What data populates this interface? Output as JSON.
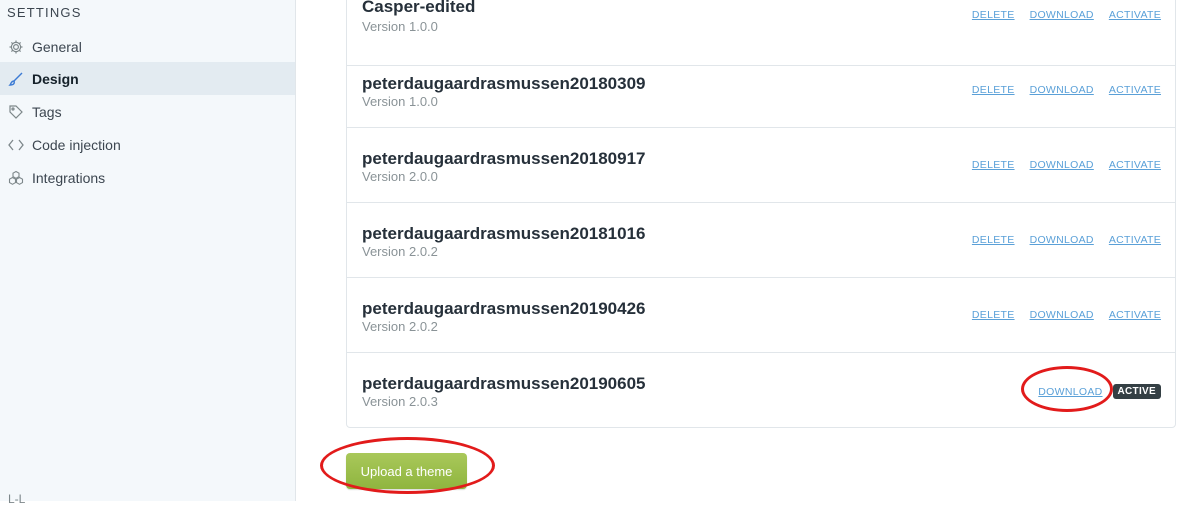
{
  "sidebar": {
    "heading": "SETTINGS",
    "items": [
      {
        "label": "General",
        "icon": "gear-icon"
      },
      {
        "label": "Design",
        "icon": "brush-icon",
        "active": true
      },
      {
        "label": "Tags",
        "icon": "tag-icon"
      },
      {
        "label": "Code injection",
        "icon": "code-icon"
      },
      {
        "label": "Integrations",
        "icon": "integrations-icon"
      }
    ],
    "bottom_partial": "L-L"
  },
  "themes": [
    {
      "name": "Casper-edited",
      "version": "Version 1.0.0",
      "actions": [
        "DELETE",
        "DOWNLOAD",
        "ACTIVATE"
      ]
    },
    {
      "name": "peterdaugaardrasmussen20180309",
      "version": "Version 1.0.0",
      "actions": [
        "DELETE",
        "DOWNLOAD",
        "ACTIVATE"
      ]
    },
    {
      "name": "peterdaugaardrasmussen20180917",
      "version": "Version 2.0.0",
      "actions": [
        "DELETE",
        "DOWNLOAD",
        "ACTIVATE"
      ]
    },
    {
      "name": "peterdaugaardrasmussen20181016",
      "version": "Version 2.0.2",
      "actions": [
        "DELETE",
        "DOWNLOAD",
        "ACTIVATE"
      ]
    },
    {
      "name": "peterdaugaardrasmussen20190426",
      "version": "Version 2.0.2",
      "actions": [
        "DELETE",
        "DOWNLOAD",
        "ACTIVATE"
      ]
    },
    {
      "name": "peterdaugaardrasmussen20190605",
      "version": "Version 2.0.3",
      "actions": [
        "DOWNLOAD"
      ],
      "badge": "ACTIVE"
    }
  ],
  "upload_button": "Upload a theme",
  "colors": {
    "accent_green": "#9fbb58",
    "link_blue": "#5aa0d8",
    "annotation_red": "#e21b1b"
  }
}
